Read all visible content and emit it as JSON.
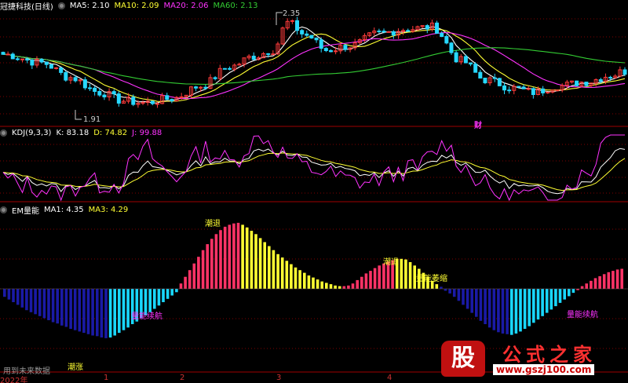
{
  "colors": {
    "background": "#000000",
    "up_candle": "#ff3b3b",
    "down_candle": "#27d8ff",
    "ma5": "#ffffff",
    "ma10": "#ffff33",
    "ma20": "#ff33ff",
    "ma60": "#33cc33",
    "k_line": "#ffffff",
    "d_line": "#ffff33",
    "j_line": "#ff33ff",
    "em_red": "#ff3366",
    "em_yellow": "#ffff33",
    "em_cyan": "#19d7ff",
    "em_navy": "#1a1aa6",
    "label_yellow": "#ffff33",
    "label_magenta": "#ff33ff",
    "grid_red": "#800000"
  },
  "price_panel": {
    "title": "冠捷科技(日线)",
    "ma5_label": "MA5: 2.10",
    "ma10_label": "MA10: 2.09",
    "ma20_label": "MA20: 2.06",
    "ma60_label": "MA60: 2.13",
    "high_marker": "2.35",
    "low_marker": "1.91",
    "event_tag": "财"
  },
  "kdj_panel": {
    "title": "KDJ(9,3,3)",
    "k_label": "K: 83.18",
    "d_label": "D: 74.82",
    "j_label": "J: 99.88"
  },
  "em_panel": {
    "title": "EM量能",
    "ma1_label": "MA1: 4.35",
    "ma3_label": "MA3: 4.29",
    "annotations": [
      {
        "text": "潮退",
        "color": "#ffff33"
      },
      {
        "text": "潮退",
        "color": "#ffff33"
      },
      {
        "text": "潮涨",
        "color": "#ffff33"
      },
      {
        "text": "量能萎缩",
        "color": "#ffff33"
      },
      {
        "text": "量能续航",
        "color": "#ff33ff"
      },
      {
        "text": "量能续航",
        "color": "#ff33ff"
      }
    ],
    "footer_note": "用到未来数据"
  },
  "x_axis": {
    "labels": [
      "2022年",
      "1",
      "2",
      "3",
      "4"
    ]
  },
  "watermark": {
    "badge": "股",
    "title": "公式之家",
    "url": "www.gszj100.com"
  },
  "chart_data": [
    {
      "type": "candlestick",
      "title": "冠捷科技(日线)",
      "yrange": [
        1.85,
        2.4
      ],
      "high": 2.35,
      "low": 1.91,
      "series": [
        {
          "name": "MA5",
          "last": 2.1
        },
        {
          "name": "MA10",
          "last": 2.09
        },
        {
          "name": "MA20",
          "last": 2.06
        },
        {
          "name": "MA60",
          "last": 2.13
        }
      ]
    },
    {
      "type": "line",
      "title": "KDJ(9,3,3)",
      "ylim": [
        0,
        100
      ],
      "series": [
        {
          "name": "K",
          "last": 83.18
        },
        {
          "name": "D",
          "last": 74.82
        },
        {
          "name": "J",
          "last": 99.88
        }
      ]
    },
    {
      "type": "bar",
      "title": "EM量能",
      "series": [
        {
          "name": "MA1",
          "last": 4.35
        },
        {
          "name": "MA3",
          "last": 4.29
        }
      ],
      "values": [
        -1.2,
        -1.6,
        -2.0,
        -2.4,
        -2.8,
        -3.2,
        -3.5,
        -3.8,
        -4.1,
        -4.4,
        -4.7,
        -5.0,
        -5.2,
        -5.5,
        -5.7,
        -6.0,
        -6.2,
        -6.4,
        -6.6,
        -6.8,
        -7.0,
        -7.1,
        -7.3,
        -7.4,
        -7.3,
        -7.0,
        -6.6,
        -6.2,
        -5.8,
        -5.3,
        -4.9,
        -4.4,
        -4.0,
        -3.5,
        -3.0,
        -2.5,
        -2.0,
        -1.5,
        -1.0,
        -0.5,
        0.8,
        1.8,
        2.8,
        3.8,
        4.8,
        5.8,
        6.7,
        7.5,
        8.2,
        8.8,
        9.3,
        9.6,
        9.8,
        9.9,
        9.6,
        9.2,
        8.7,
        8.2,
        7.6,
        7.0,
        6.4,
        5.8,
        5.2,
        4.7,
        4.2,
        3.7,
        3.2,
        2.8,
        2.4,
        2.0,
        1.7,
        1.4,
        1.1,
        0.9,
        0.7,
        0.5,
        0.4,
        0.4,
        0.5,
        0.8,
        1.3,
        1.8,
        2.3,
        2.7,
        3.1,
        3.5,
        3.8,
        4.1,
        4.3,
        4.5,
        4.5,
        4.4,
        4.0,
        3.5,
        3.0,
        2.4,
        1.8,
        1.2,
        0.7,
        0.3,
        -0.3,
        -0.7,
        -1.2,
        -1.8,
        -2.4,
        -3.0,
        -3.6,
        -4.2,
        -4.8,
        -5.3,
        -5.8,
        -6.2,
        -6.5,
        -6.7,
        -6.8,
        -6.9,
        -6.7,
        -6.4,
        -6.0,
        -5.6,
        -5.1,
        -4.6,
        -4.1,
        -3.6,
        -3.1,
        -2.6,
        -2.1,
        -1.6,
        -1.1,
        -0.6,
        -0.2,
        0.4,
        0.8,
        1.2,
        1.6,
        1.9,
        2.2,
        2.5,
        2.7,
        2.9,
        3.0
      ],
      "colors": [
        "navy",
        "navy",
        "navy",
        "navy",
        "navy",
        "navy",
        "navy",
        "navy",
        "navy",
        "navy",
        "navy",
        "navy",
        "navy",
        "navy",
        "navy",
        "navy",
        "navy",
        "navy",
        "navy",
        "navy",
        "navy",
        "navy",
        "navy",
        "navy",
        "cyan",
        "cyan",
        "cyan",
        "cyan",
        "cyan",
        "cyan",
        "cyan",
        "cyan",
        "cyan",
        "cyan",
        "cyan",
        "cyan",
        "cyan",
        "cyan",
        "cyan",
        "cyan",
        "red",
        "red",
        "red",
        "red",
        "red",
        "red",
        "red",
        "red",
        "red",
        "red",
        "red",
        "red",
        "red",
        "red",
        "yellow",
        "yellow",
        "yellow",
        "yellow",
        "yellow",
        "yellow",
        "yellow",
        "yellow",
        "yellow",
        "yellow",
        "yellow",
        "yellow",
        "yellow",
        "yellow",
        "yellow",
        "yellow",
        "yellow",
        "yellow",
        "yellow",
        "yellow",
        "yellow",
        "yellow",
        "yellow",
        "red",
        "red",
        "red",
        "red",
        "red",
        "red",
        "red",
        "red",
        "red",
        "red",
        "red",
        "red",
        "yellow",
        "yellow",
        "yellow",
        "yellow",
        "yellow",
        "yellow",
        "yellow",
        "yellow",
        "yellow",
        "yellow",
        "navy",
        "navy",
        "navy",
        "navy",
        "navy",
        "navy",
        "navy",
        "navy",
        "navy",
        "navy",
        "navy",
        "navy",
        "navy",
        "navy",
        "navy",
        "navy",
        "cyan",
        "cyan",
        "cyan",
        "cyan",
        "cyan",
        "cyan",
        "cyan",
        "cyan",
        "cyan",
        "cyan",
        "cyan",
        "cyan",
        "cyan",
        "cyan",
        "cyan",
        "red",
        "red",
        "red",
        "red",
        "red",
        "red",
        "red",
        "red",
        "red",
        "red",
        "red"
      ]
    }
  ]
}
